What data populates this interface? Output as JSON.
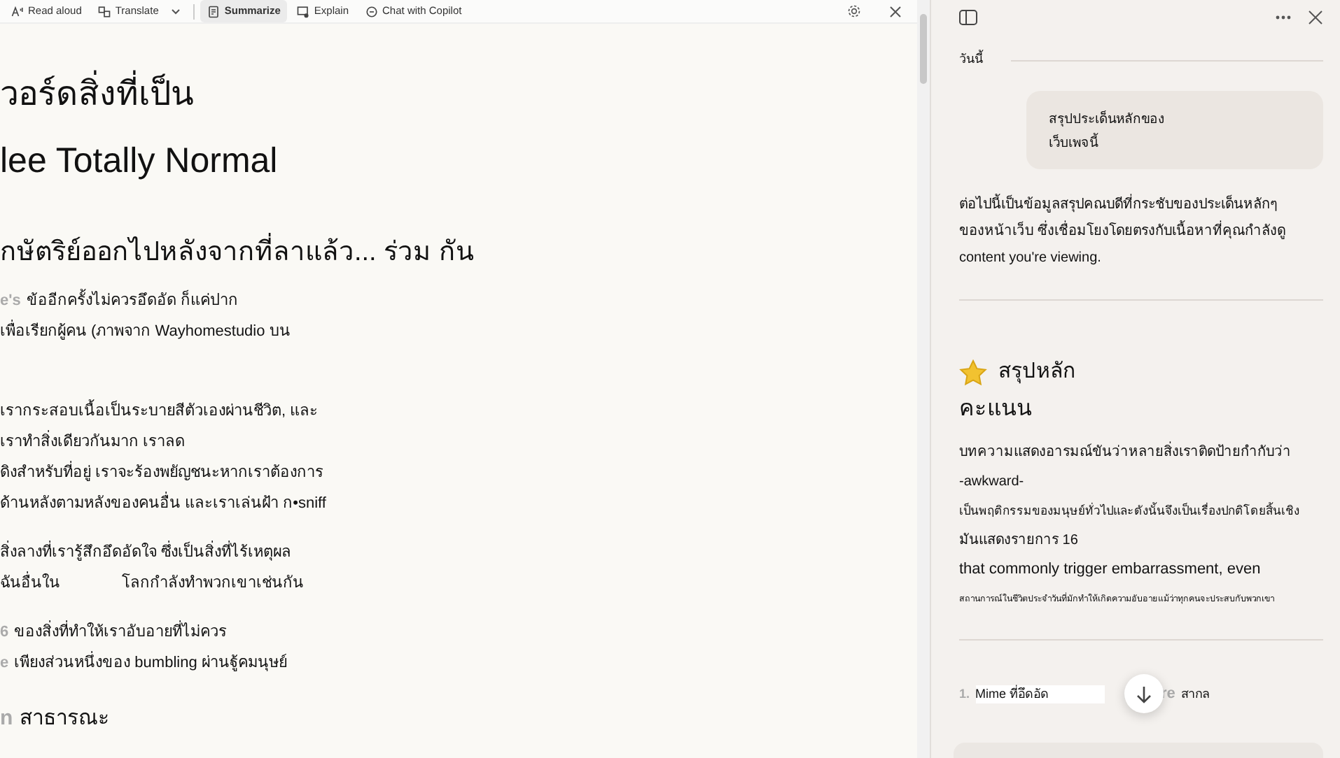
{
  "toolbar": {
    "items": [
      {
        "label": "Read aloud",
        "selected": false,
        "dropdown": false
      },
      {
        "label": "Translate",
        "selected": false,
        "dropdown": true
      },
      {
        "label": "Summarize",
        "selected": true,
        "dropdown": false
      },
      {
        "label": "Explain",
        "selected": false,
        "dropdown": false
      },
      {
        "label": "Chat with Copilot",
        "selected": false,
        "dropdown": false
      }
    ]
  },
  "article": {
    "title_lines": [
      "วอร์ดสิ่งที่เป็น",
      "lee Totally Normal"
    ],
    "subtitle": "กษัตริย์ออกไปหลังจากที่ลาแล้ว... ร่วม กัน",
    "paragraphs": [
      [
        {
          "prefix": "e's",
          "text": "ข้ออีกครั้งไม่ควรอึดอัด ก็แค่ปาก"
        },
        {
          "text": "เพื่อเรียกผู้คน (ภาพจาก Wayhomestudio บน"
        }
      ],
      [
        {
          "text": "เรากระสอบเนื้อเป็นระบายสีตัวเองผ่านชีวิต, และ"
        },
        {
          "text": "เราทำสิ่งเดียวกันมาก เราลด"
        },
        {
          "text": "ดิงสำหรับที่อยู่ เราจะร้องพยัญชนะหากเราต้องการ"
        },
        {
          "text": "ด้านหลังตามหลังของคนอื่น และเราเล่นฝ้า ก•sniff"
        }
      ],
      [
        {
          "text": "สิ่งลางที่เรารู้สึกอึดอัดใจ ซึ่งเป็นสิ่งที่ไร้เหตุผล"
        },
        {
          "text": "ฉันอื่นใน",
          "text2": "โลกกำลังทำพวกเขาเช่นกัน"
        }
      ],
      [
        {
          "prefix": "6",
          "text": "ของสิ่งที่ทำให้เราอับอายที่ไม่ควร"
        },
        {
          "prefix": "e",
          "text": "เพียงส่วนหนึ่งของ bumbling ผ่านฐู้คมนุษย์"
        }
      ]
    ],
    "section": {
      "prefix": "n",
      "text": "สาธารณะ"
    }
  },
  "panel": {
    "date_label": "วันนี้",
    "user_message": "สรุปประเด็นหลักของ\nเว็บเพจนี้",
    "reply": "ต่อไปนี้เป็นข้อมูลสรุปคณบดีที่กระชับของประเด็นหลักๆ\nของหน้าเว็บ ซึ่งเชื่อมโยงโดยตรงกับเนื้อหาที่คุณกำลังดู\ncontent you're viewing.",
    "summary_title": "สรุปหลัก",
    "summary_subtitle": "คะแนน",
    "summary_lines": [
      "บทความแสดงอารมณ์ขันว่าหลายสิ่งเราติดป้ายกำกับว่า",
      "-awkward-",
      "เป็นพฤติกรรมของมนุษย์ทั่วไปและดังนั้นจึงเป็นเรื่องปกติโดยสิ้นเชิง",
      "มันแสดงรายการ 16",
      "that commonly trigger embarrassment, even",
      "สถานการณ์ในชีวิตประจำวันที่มักทำให้เกิดความอับอายแม้ว่าทุกคนจะประสบกับพวกเขา"
    ],
    "list_item": {
      "number": "1.",
      "text": "Mime ที่อึดอัด",
      "tail": "re",
      "end": "สากล"
    }
  }
}
